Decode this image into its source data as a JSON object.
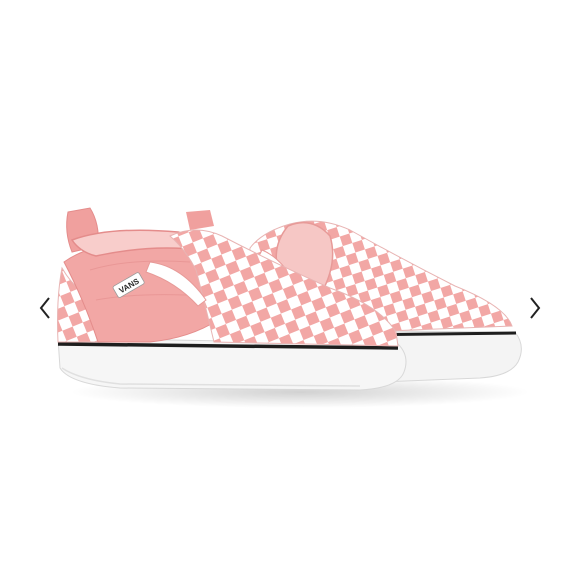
{
  "viewer": {
    "prev_icon": "chevron-left-icon",
    "next_icon": "chevron-right-icon"
  },
  "product": {
    "brand_label": "VANS",
    "colors": {
      "pink": "#f2a7a5",
      "pink_dark": "#e78f8f",
      "white": "#ffffff",
      "sole_stripe": "#1e1e1e",
      "sole_gray": "#e9e9e9"
    }
  }
}
